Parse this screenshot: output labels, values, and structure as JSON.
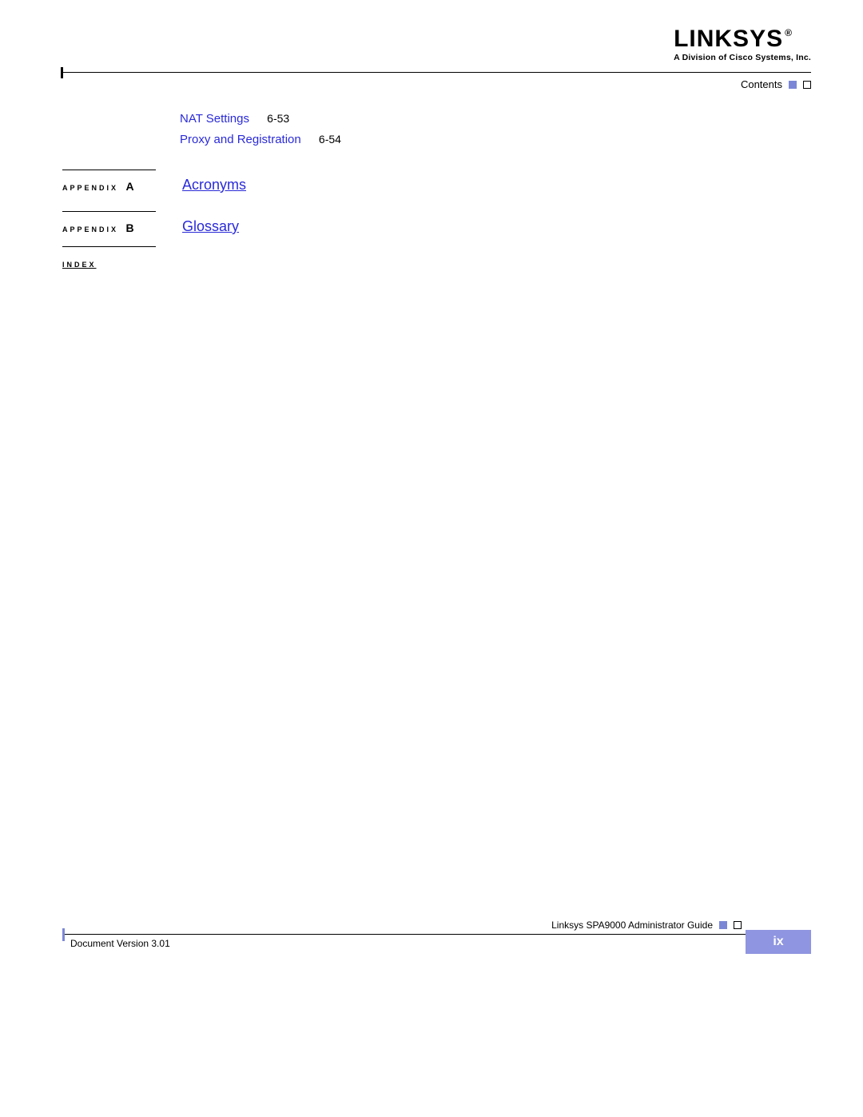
{
  "logo": {
    "brand": "LINKSYS",
    "registered": "®",
    "tagline": "A Division of Cisco Systems, Inc."
  },
  "header": {
    "section_label": "Contents"
  },
  "toc": {
    "entries": [
      {
        "title": "NAT Settings",
        "page": "6-53"
      },
      {
        "title": "Proxy and Registration",
        "page": "6-54"
      }
    ]
  },
  "appendices": [
    {
      "label": "APPENDIX",
      "letter": "A",
      "title": "Acronyms"
    },
    {
      "label": "APPENDIX",
      "letter": "B",
      "title": "Glossary"
    }
  ],
  "index": {
    "label": "INDEX"
  },
  "footer": {
    "doc_version": "Document Version 3.01",
    "guide_title": "Linksys SPA9000 Administrator Guide",
    "page_number": "ix"
  }
}
